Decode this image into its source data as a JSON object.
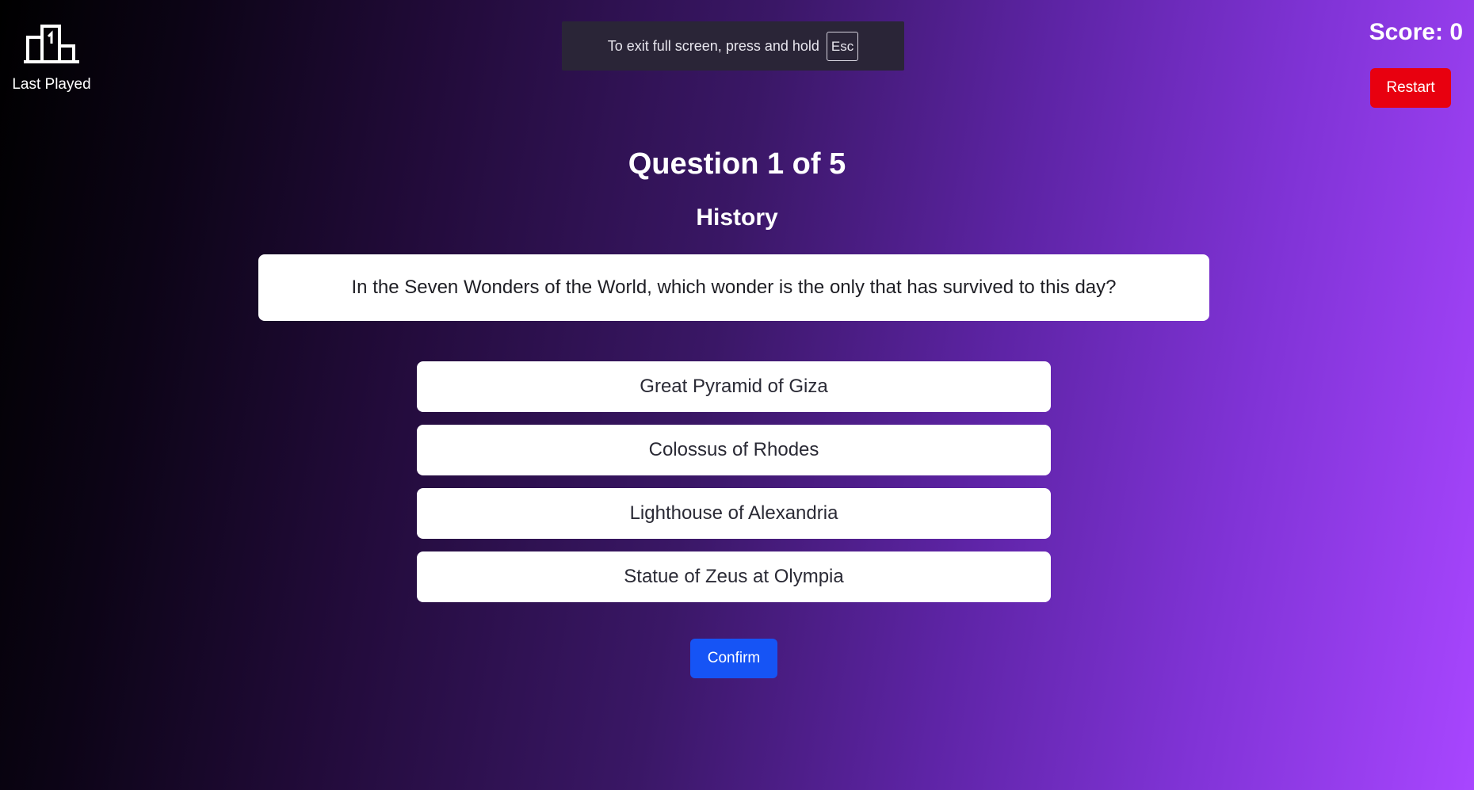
{
  "last_played": {
    "icon": "podium-icon",
    "label": "Last Played"
  },
  "fullscreen_notice": {
    "text": "To exit full screen, press and hold",
    "key": "Esc"
  },
  "score": {
    "label": "Score: 0",
    "value": 0
  },
  "restart": {
    "label": "Restart",
    "color": "#e8000f"
  },
  "quiz": {
    "progress_label": "Question 1 of 5",
    "current_question": 1,
    "total_questions": 5,
    "category": "History",
    "question": "In the Seven Wonders of the World, which wonder is the only that has survived to this day?",
    "answers": [
      "Great Pyramid of Giza",
      "Colossus of Rhodes",
      "Lighthouse of Alexandria",
      "Statue of Zeus at Olympia"
    ]
  },
  "confirm": {
    "label": "Confirm",
    "color": "#1654f5"
  },
  "theme": {
    "gradient_start": "#000000",
    "gradient_end": "#a846ff"
  }
}
